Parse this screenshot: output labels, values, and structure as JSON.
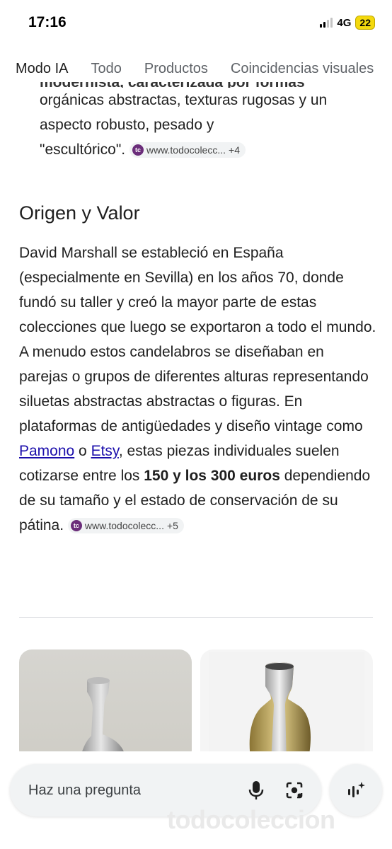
{
  "status_bar": {
    "time": "17:16",
    "network": "4G",
    "battery": "22"
  },
  "tabs": [
    "Modo IA",
    "Todo",
    "Productos",
    "Coincidencias visuales"
  ],
  "bullet_continuation": {
    "cut_line": "modernista, caracterizada por formas",
    "line1": "orgánicas abstractas, texturas rugosas y un",
    "line2": "aspecto robusto, pesado y",
    "line3": "\"escultórico\".",
    "chip": {
      "logo": "tc",
      "site": "www.todocolecc...",
      "extra": "+4"
    }
  },
  "section": {
    "title": "Origen y Valor",
    "text_before_link1": "David Marshall se estableció en España (especialmente en Sevilla) en los años 70, donde fundó su taller y creó la mayor parte de estas colecciones que luego se exportaron a todo el mundo. A menudo estos candelabros se diseñaban en parejas o grupos de diferentes alturas representando siluetas abstractas abstractas o figuras. En plataformas de antigüedades y diseño vintage como ",
    "link1": "Pamono",
    "between_links": " o ",
    "link2": "Etsy",
    "text_after_link2": ", estas piezas individuales suelen cotizarse entre los ",
    "bold_price": "150 y los 300 euros",
    "text_end": " dependiendo de su tamaño y el estado de conservación de su pátina.",
    "chip": {
      "logo": "tc",
      "site": "www.todocolecc...",
      "extra": "+5"
    }
  },
  "ask": {
    "placeholder": "Haz una pregunta"
  },
  "icons": [
    "mic-icon",
    "lens-icon",
    "live-mode-icon"
  ],
  "watermark": "todocoleccion",
  "colors": {
    "link": "#1a0dab",
    "chip_bg": "#f1f3f4",
    "logo_purple": "#6b2d7a"
  }
}
